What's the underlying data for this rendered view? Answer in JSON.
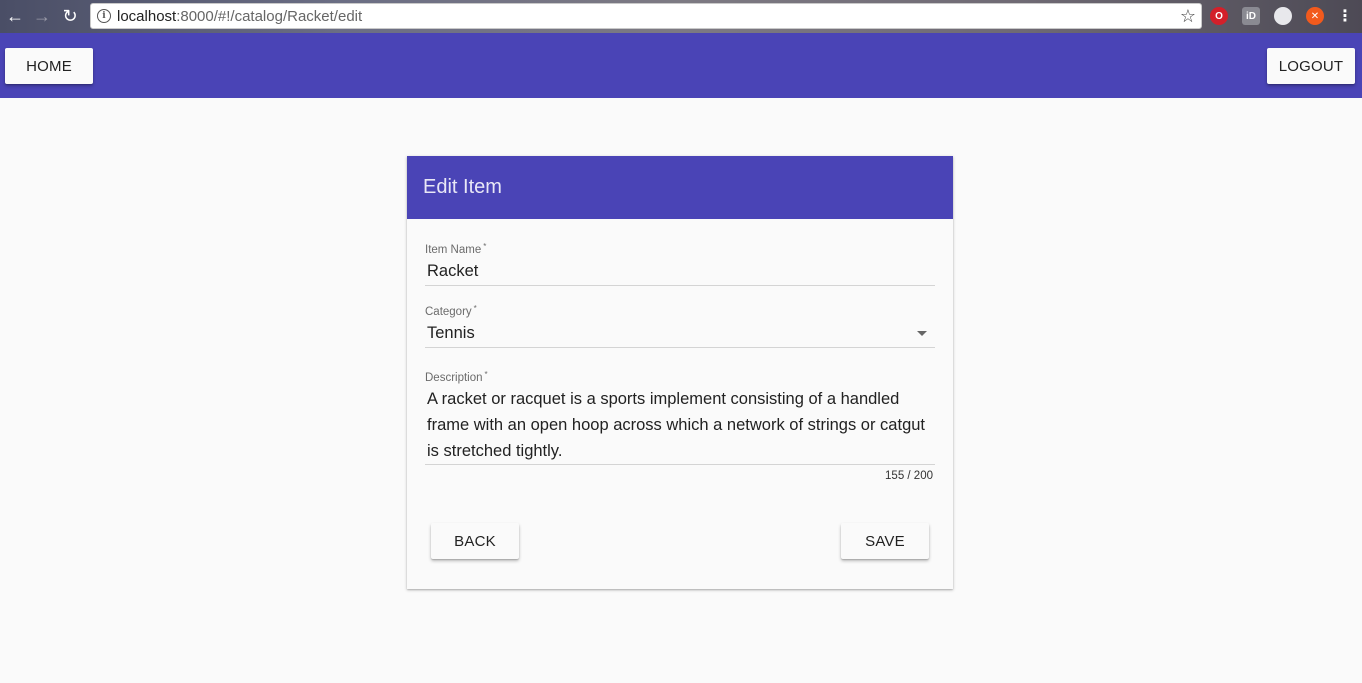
{
  "browser": {
    "url_host": "localhost",
    "url_rest": ":8000/#!/catalog/Racket/edit"
  },
  "toolbar": {
    "home_label": "HOME",
    "logout_label": "LOGOUT"
  },
  "card": {
    "title": "Edit Item",
    "item_name": {
      "label": "Item Name",
      "required_mark": "*",
      "value": "Racket"
    },
    "category": {
      "label": "Category",
      "required_mark": "*",
      "value": "Tennis"
    },
    "description": {
      "label": "Description",
      "required_mark": "*",
      "value": "A racket or racquet is a sports implement consisting of a handled frame with an open hoop across which a network of strings or catgut is stretched tightly.",
      "counter": "155 / 200"
    },
    "back_label": "BACK",
    "save_label": "SAVE"
  },
  "colors": {
    "primary": "#4a44b6",
    "background": "#fafafa"
  },
  "icons": [
    "back-arrow-icon",
    "forward-arrow-icon",
    "reload-icon",
    "info-icon",
    "star-icon",
    "dropdown-arrow-icon"
  ]
}
